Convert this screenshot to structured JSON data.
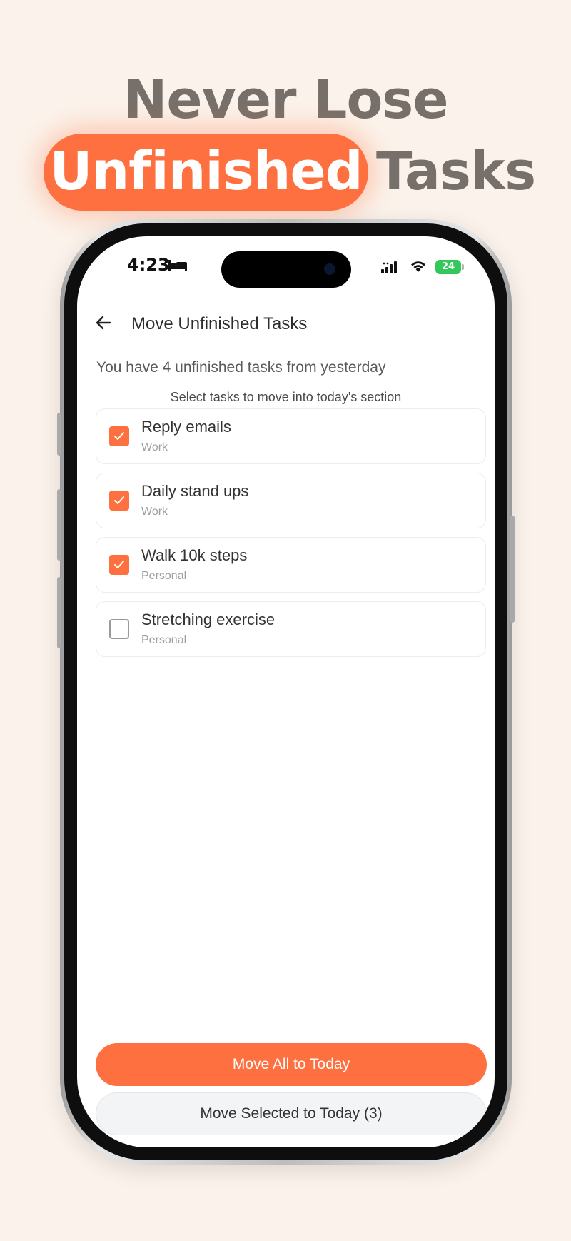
{
  "headline": {
    "line1": "Never Lose",
    "highlight": "Unfinished",
    "line2_rest": "Tasks"
  },
  "colors": {
    "accent": "#fe7040",
    "background": "#fbf3eb",
    "headline_text": "#77706a",
    "battery": "#34c759"
  },
  "status_bar": {
    "time": "4:23",
    "status_icon": "bed-icon",
    "battery_level": "24"
  },
  "screen": {
    "title": "Move Unfinished Tasks",
    "summary": "You have 4 unfinished tasks from yesterday",
    "instruction": "Select tasks to move into today's section",
    "tasks": [
      {
        "title": "Reply emails",
        "category": "Work",
        "checked": true
      },
      {
        "title": "Daily stand ups",
        "category": "Work",
        "checked": true
      },
      {
        "title": "Walk 10k steps",
        "category": "Personal",
        "checked": true
      },
      {
        "title": "Stretching exercise",
        "category": "Personal",
        "checked": false
      }
    ],
    "buttons": {
      "move_all": "Move All to Today",
      "move_selected": "Move Selected to Today (3)"
    }
  }
}
